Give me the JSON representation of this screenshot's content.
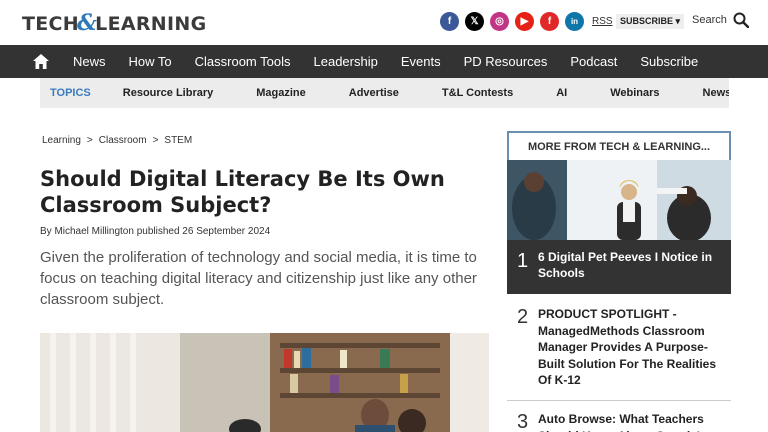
{
  "header": {
    "logo_left": "TECH",
    "logo_amp": "&",
    "logo_right": "LEARNING",
    "rss": "RSS",
    "subscribe": "SUBSCRIBE ▾",
    "search": "Search",
    "social_icons": [
      "facebook-icon",
      "x-icon",
      "instagram-icon",
      "youtube-icon",
      "flipboard-icon",
      "linkedin-icon"
    ],
    "social_glyphs": [
      "f",
      "𝕏",
      "◎",
      "▶",
      "f",
      "in"
    ],
    "social_colors": [
      "#3b5998",
      "#000000",
      "#c13584",
      "#e62117",
      "#e12828",
      "#0e76a8"
    ]
  },
  "nav": {
    "items": [
      "News",
      "How To",
      "Classroom Tools",
      "Leadership",
      "Events",
      "PD Resources",
      "Podcast",
      "Subscribe"
    ]
  },
  "topics": {
    "label": "TOPICS",
    "items": [
      "Resource Library",
      "Magazine",
      "Advertise",
      "T&L Contests",
      "AI",
      "Webinars",
      "News Sig"
    ]
  },
  "article": {
    "breadcrumb": [
      "Learning",
      "Classroom",
      "STEM"
    ],
    "breadcrumb_sep": ">",
    "title": "Should Digital Literacy Be Its Own Classroom Subject?",
    "byline": "By Michael Millington published 26 September 2024",
    "lede": "Given the proliferation of technology and social media, it is time to focus on teaching digital literacy and citizenship just like any other classroom subject."
  },
  "sidebar": {
    "heading": "MORE FROM TECH & LEARNING...",
    "items": [
      {
        "num": "1",
        "title": "6 Digital Pet Peeves I Notice in Schools"
      },
      {
        "num": "2",
        "title": "PRODUCT SPOTLIGHT - ManagedMethods Classroom Manager Provides A Purpose-Built Solution For The Realities Of K-12"
      },
      {
        "num": "3",
        "title": "Auto Browse: What Teachers Should Know About Google's"
      }
    ]
  },
  "colors": {
    "nav_bg": "#333333",
    "topics_label": "#3a7bbf",
    "topics_bg": "#ececec",
    "sidebar_border": "#6b8fb2"
  }
}
